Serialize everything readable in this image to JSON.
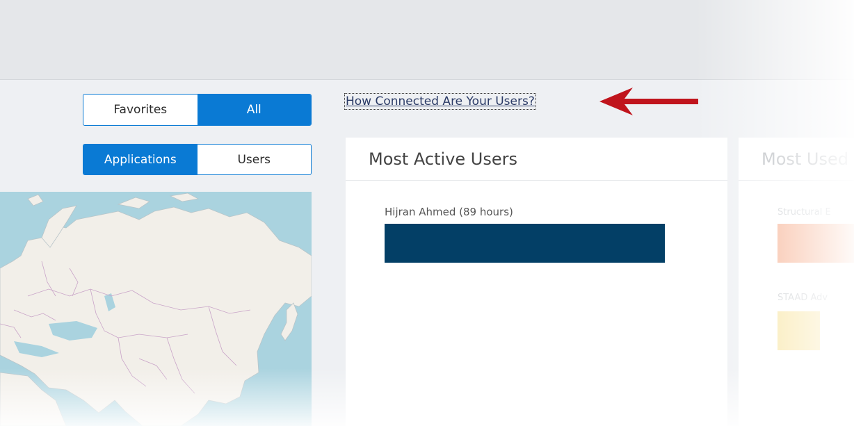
{
  "toggle_view": {
    "options": [
      "Favorites",
      "All"
    ],
    "selected": "All"
  },
  "toggle_scope": {
    "options": [
      "Applications",
      "Users"
    ],
    "selected": "Applications"
  },
  "help_link": "How Connected Are Your Users?",
  "most_active_users": {
    "title": "Most Active Users",
    "items": [
      {
        "label": "Hijran Ahmed (89 hours)",
        "hours": 89,
        "bar_fraction": 1.0
      }
    ],
    "bar_color": "#033f66"
  },
  "most_used_apps": {
    "title": "Most Used",
    "items": [
      {
        "label": "Structural E",
        "color": "#f5a07a"
      },
      {
        "label": "STAAD Adv",
        "color": "#f7df8e"
      }
    ]
  },
  "colors": {
    "accent": "#0a7ad4",
    "arrow": "#c0141c",
    "map_water": "#aad3df",
    "map_land": "#f2efe9",
    "map_borders": "#c9a4c8"
  }
}
